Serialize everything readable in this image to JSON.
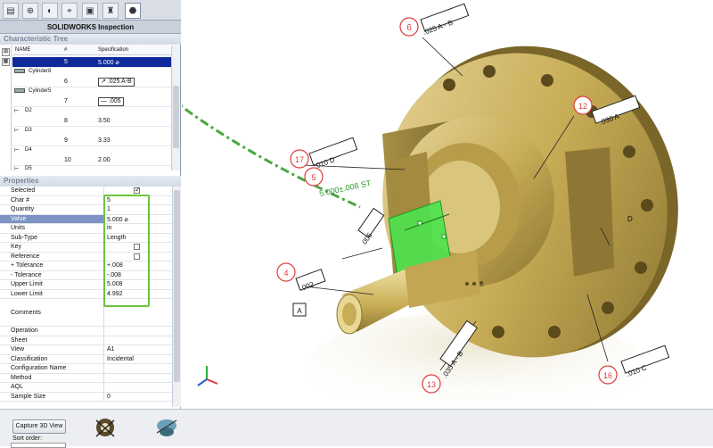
{
  "panel_title": "SOLIDWORKS Inspection",
  "tabs": [
    "feature-manager-icon",
    "property-icon",
    "configuration-icon",
    "dimxpert-icon",
    "display-icon",
    "appearance-icon",
    "inspection-icon"
  ],
  "tree": {
    "header": "Characteristic Tree",
    "columns": {
      "name": "NAME",
      "num": "#",
      "spec": "Specification"
    },
    "rows": [
      {
        "kind": "row",
        "num": "5",
        "spec": "5.000 ⌀",
        "selected": true
      },
      {
        "kind": "node",
        "name": "Cylinder8"
      },
      {
        "kind": "row",
        "num": "6",
        "spec": "↗ .025 A-B"
      },
      {
        "kind": "node",
        "name": "Cylinder5"
      },
      {
        "kind": "row",
        "num": "7",
        "spec": "— .005"
      },
      {
        "kind": "node",
        "name": "D2"
      },
      {
        "kind": "row",
        "num": "8",
        "spec": "3.50"
      },
      {
        "kind": "node",
        "name": "D3"
      },
      {
        "kind": "row",
        "num": "9",
        "spec": "3.33"
      },
      {
        "kind": "node",
        "name": "D4"
      },
      {
        "kind": "row",
        "num": "10",
        "spec": "2.00"
      },
      {
        "kind": "node",
        "name": "D5"
      }
    ]
  },
  "properties": {
    "header": "Properties",
    "rows": [
      {
        "label": "Selected",
        "checkbox": true,
        "checked": true
      },
      {
        "label": "Char #",
        "value": "5"
      },
      {
        "label": "Quantity",
        "value": "1"
      },
      {
        "label": "Value",
        "value": "5.000 ⌀",
        "highlight": true
      },
      {
        "label": "Units",
        "value": "in"
      },
      {
        "label": "Sub-Type",
        "value": "Length"
      },
      {
        "label": "Key",
        "checkbox": true,
        "checked": false
      },
      {
        "label": "Reference",
        "checkbox": true,
        "checked": false
      },
      {
        "label": "+ Tolerance",
        "value": "+.008"
      },
      {
        "label": "- Tolerance",
        "value": "-.008"
      },
      {
        "label": "Upper Limit",
        "value": "5.008"
      },
      {
        "label": "Lower Limit",
        "value": "4.992"
      },
      {
        "label": "Comments",
        "value": "",
        "tall": true
      },
      {
        "label": "Operation",
        "value": ""
      },
      {
        "label": "Sheet",
        "value": ""
      },
      {
        "label": "View",
        "value": "A1"
      },
      {
        "label": "Classification",
        "value": "Incidental"
      },
      {
        "label": "Configuration Name",
        "value": ""
      },
      {
        "label": "Method",
        "value": ""
      },
      {
        "label": "AQL",
        "value": ""
      },
      {
        "label": "Sample Size",
        "value": "0"
      }
    ]
  },
  "bottom": {
    "capture_label": "Capture 3D View",
    "sort_label": "Sort order:"
  },
  "balloons": [
    {
      "num": "4",
      "label": ".002",
      "datum": "A"
    },
    {
      "num": "5",
      "label": "5.000±.008 ST"
    },
    {
      "num": "6",
      "label": ".025 A - B"
    },
    {
      "num": "12",
      "label": ".030 A"
    },
    {
      "num": "13",
      "label": ".035 A - B"
    },
    {
      "num": "16",
      "label": ".010 C"
    },
    {
      "num": "17",
      "label": ".010 D"
    }
  ],
  "annotations": {
    "short_label": ".005",
    "side_label": "D"
  },
  "colors": {
    "accent_green": "#3fb23a",
    "balloon_red": "#e03a3a",
    "selection_blue": "#0e2a9a",
    "part_gold": "#c8ad57"
  }
}
